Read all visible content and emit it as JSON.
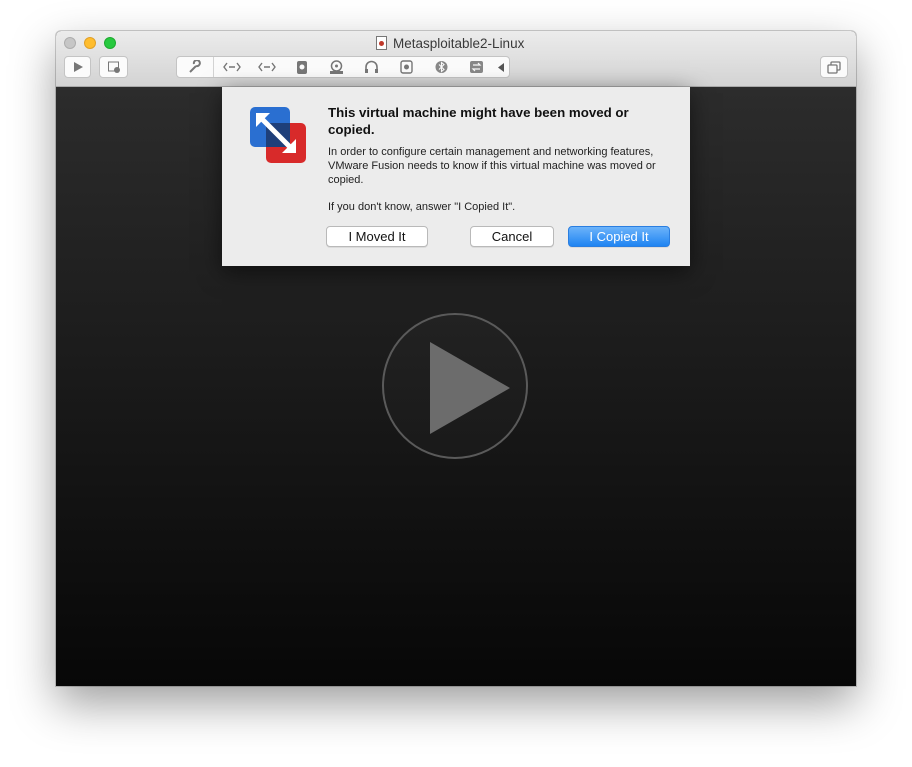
{
  "window": {
    "title": "Metasploitable2-Linux"
  },
  "toolbar": {
    "icons": [
      "play-icon",
      "snapshot-icon",
      "wrench-icon",
      "network-icon",
      "network-icon",
      "hard-disk-icon",
      "cd-icon",
      "sound-icon",
      "camera-icon",
      "bluetooth-icon",
      "usb-icon",
      "chevron-left-icon",
      "fullscreen-icon"
    ]
  },
  "dialog": {
    "title": "This virtual machine might have been moved or copied.",
    "body": "In order to configure certain management and networking features, VMware Fusion needs to know if this virtual machine was moved or copied.",
    "hint": "If you don't know, answer \"I Copied It\".",
    "buttons": {
      "moved": "I Moved It",
      "cancel": "Cancel",
      "copied": "I Copied It"
    }
  },
  "colors": {
    "accent": "#1f84f2",
    "background": "#111111",
    "dialog_bg": "#ececec"
  }
}
